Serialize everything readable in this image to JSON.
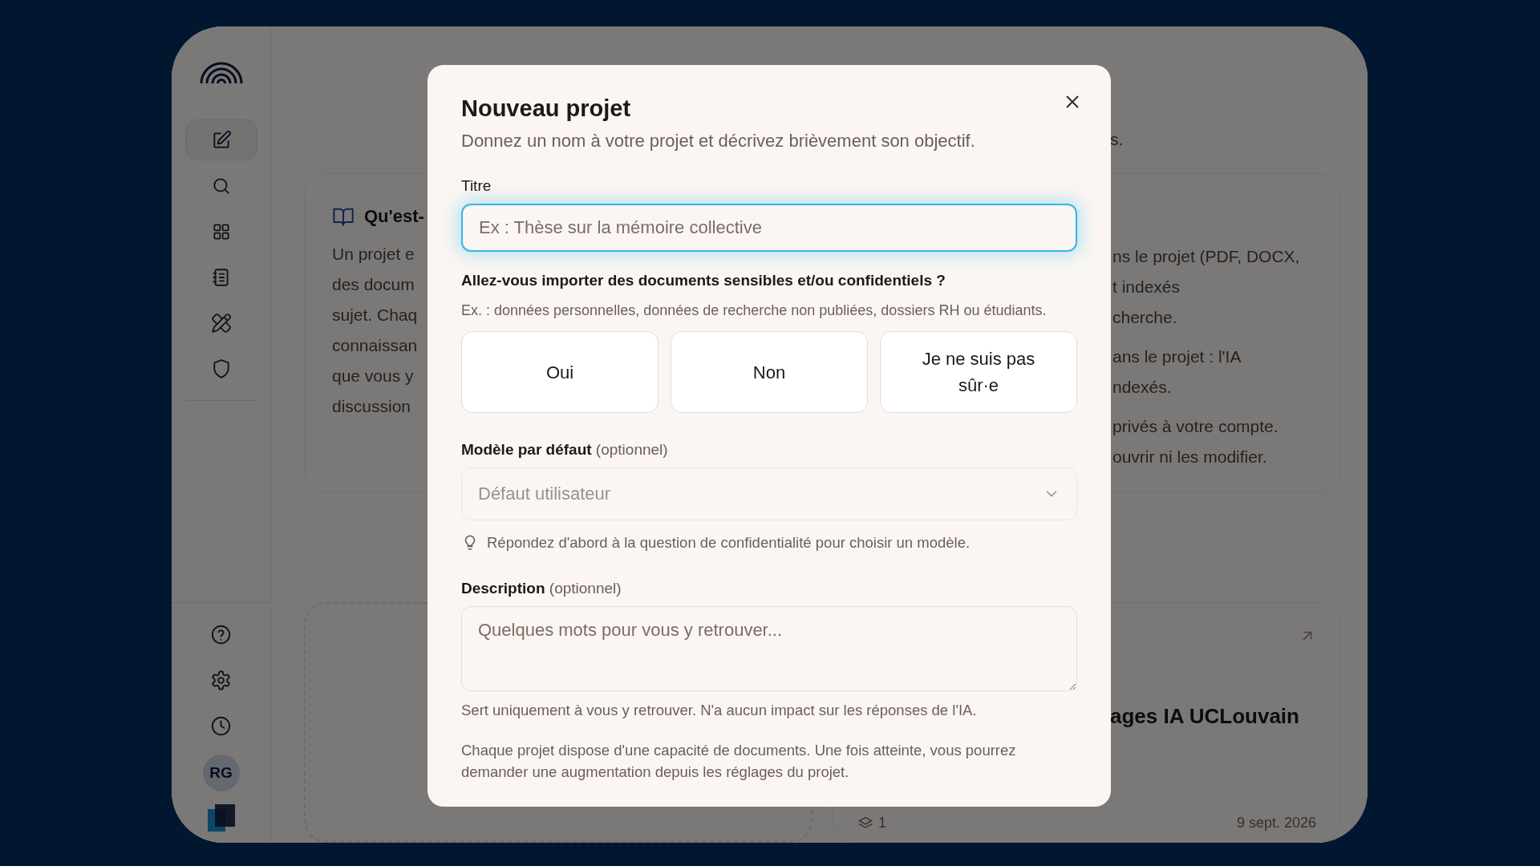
{
  "sidebar": {
    "nav_items": [
      {
        "selected": true
      },
      {
        "selected": false
      },
      {
        "selected": false
      },
      {
        "selected": false
      },
      {
        "selected": false
      },
      {
        "selected": false
      }
    ],
    "bottom_items": [
      {
        "selected": false
      },
      {
        "selected": false
      },
      {
        "selected": false
      }
    ],
    "avatar": "RG"
  },
  "background": {
    "intro_tail": "s.",
    "info_cards": [
      {
        "title": "Qu'est-",
        "paragraphs": [
          [
            "Un projet e",
            "des docum",
            "sujet. Chaq",
            "connaissan",
            "que vous y",
            "discussion"
          ]
        ]
      },
      {
        "paragraphs": [
          [
            "ns le projet (PDF, DOCX,",
            "t indexés",
            "cherche."
          ],
          [
            "ans le projet : l'IA",
            "ndexés."
          ],
          [
            "privés à votre compte.",
            "ouvrir ni les modifier."
          ]
        ]
      }
    ],
    "project_card": {
      "title": "ages IA UCLouvain",
      "count": "1",
      "date": "9 sept. 2026"
    }
  },
  "dialog": {
    "title": "Nouveau projet",
    "subtitle": "Donnez un nom à votre projet et décrivez brièvement son objectif.",
    "title_field": {
      "label": "Titre",
      "placeholder": "Ex : Thèse sur la mémoire collective",
      "focused": true
    },
    "question": "Allez-vous importer des documents sensibles et/ou confidentiels ?",
    "question_hint": "Ex. : données personnelles, données de recherche non publiées, dossiers RH ou étudiants.",
    "options": [
      {
        "label": "Oui",
        "selected": false
      },
      {
        "label": "Non",
        "selected": false
      },
      {
        "label": "Je ne suis pas sûr·e",
        "selected": false
      }
    ],
    "model_field": {
      "label": "Modèle par défaut",
      "optional": "(optionnel)",
      "value": "Défaut utilisateur",
      "disabled": true
    },
    "model_tip": "Répondez d'abord à la question de confidentialité pour choisir un modèle.",
    "description_field": {
      "label": "Description",
      "optional": "(optionnel)",
      "placeholder": "Quelques mots pour vous y retrouver..."
    },
    "description_help": "Sert uniquement à vous y retrouver. N'a aucun impact sur les réponses de l'IA.",
    "capacity_note": "Chaque projet dispose d'une capacité de documents. Une fois atteinte, vous pourrez demander une augmentation depuis les réglages du projet."
  }
}
